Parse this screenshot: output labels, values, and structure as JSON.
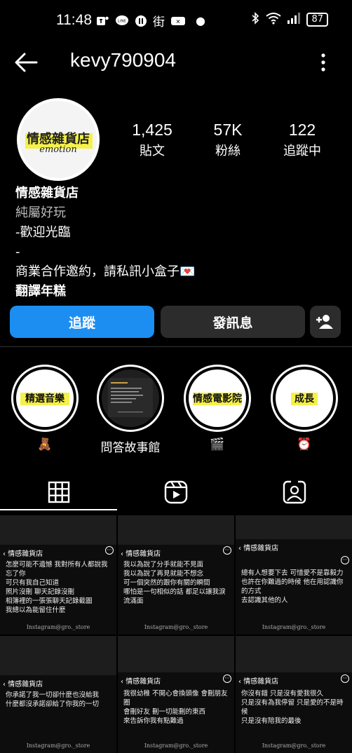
{
  "status_bar": {
    "time": "11:48",
    "battery": "87",
    "icons": [
      "teams-icon",
      "line-icon",
      "pause-icon",
      "street-icon",
      "cloud-icon",
      "dot-icon",
      "bluetooth-icon",
      "wifi-icon",
      "signal-icon"
    ]
  },
  "header": {
    "username": "kevy790904"
  },
  "profile": {
    "avatar_text_main": "情感雜貨店",
    "avatar_text_sub": "emotion",
    "stats": [
      {
        "num": "1,425",
        "label": "貼文"
      },
      {
        "num": "57K",
        "label": "粉絲"
      },
      {
        "num": "122",
        "label": "追蹤中"
      }
    ],
    "name": "情感雜貨店",
    "bio_lines": [
      "純屬好玩",
      "-歡迎光臨",
      "-",
      "商業合作邀約，請私訊小盒子💌",
      "翻譯年糕"
    ]
  },
  "buttons": {
    "follow": "追蹤",
    "message": "發訊息"
  },
  "highlights": [
    {
      "cover": "精選音樂",
      "label": "🧸"
    },
    {
      "cover": "",
      "label": "問答故事館"
    },
    {
      "cover": "情感電影院",
      "label": "🎬"
    },
    {
      "cover": "成長",
      "label": "⏰"
    }
  ],
  "grid": {
    "account": "情感雜貨店",
    "footer": "Instagram@gro._store",
    "posts": [
      [
        "怎麼可能不遺憾 我對所有人都說我忘了你",
        "可只有我自己知道",
        "照片沒刪 聊天記錄沒刪",
        "相簿裡的一張張聊天記錄截圖",
        "我總以為能留住什麼"
      ],
      [
        "我以為說了分手就能不見面",
        "我以為說了再見就能不想念",
        "可一個突然的跟你有關的瞬間",
        "哪怕是一句相似的話 都足以讓我淚流滿面"
      ],
      [
        "總有人想要下去 可惜愛不是靠毅力",
        "也許在你難過的時候 他在用認識你的方式",
        "去認識其他的人"
      ],
      [
        "你承諾了我一切卻什麼也沒給我",
        "什麼都沒承諾卻給了你我的一切"
      ],
      [
        "我很幼稚 不開心會換頭像 會刪朋友圈",
        "會刪好友 刪一切能刪的東西",
        "來告訴你我有點難過"
      ],
      [
        "你沒有錯 只是沒有愛我很久",
        "只是沒有為我停留 只是愛的不是時候",
        "只是沒有陪我的最後"
      ]
    ]
  }
}
